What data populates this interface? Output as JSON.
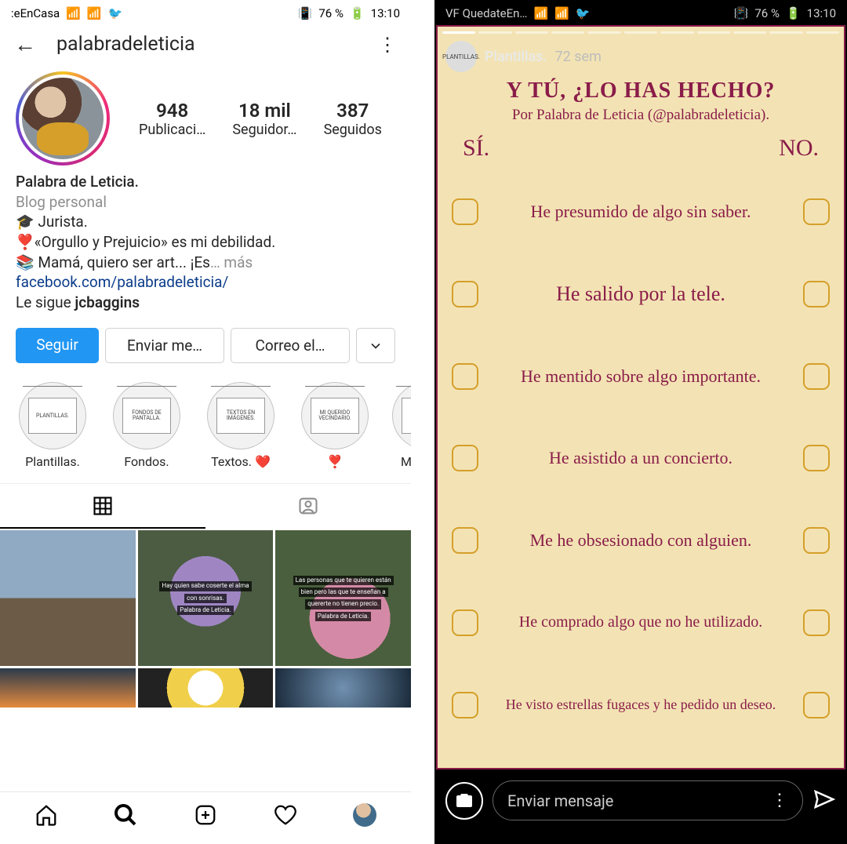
{
  "left": {
    "statusbar": {
      "carrier": ":eEnCasa",
      "battery": "76 %",
      "time": "13:10"
    },
    "topbar": {
      "username": "palabradeleticia"
    },
    "stats": {
      "posts": {
        "num": "948",
        "label": "Publicaci…"
      },
      "followers": {
        "num": "18 mil",
        "label": "Seguidor…"
      },
      "following": {
        "num": "387",
        "label": "Seguidos"
      }
    },
    "bio": {
      "name": "Palabra de Leticia.",
      "category": "Blog personal",
      "line1": "🎓 Jurista.",
      "line2": "❣️«Orgullo y Prejuicio» es mi debilidad.",
      "line3_a": "📚 Mamá, quiero ser art... ¡Es",
      "more": "… más",
      "link": "facebook.com/palabradeleticia/",
      "followed_by_prefix": "Le sigue ",
      "followed_by_name": "jcbaggins"
    },
    "actions": {
      "follow": "Seguir",
      "message": "Enviar me…",
      "email": "Correo el…"
    },
    "highlights": [
      {
        "card": "PLANTILLAS.",
        "label": "Plantillas."
      },
      {
        "card": "FONDOS DE PANTALLA.",
        "label": "Fondos."
      },
      {
        "card": "TEXTOS EN IMÁGENES.",
        "label": "Textos. ❤️"
      },
      {
        "card": "MI QUERIDO VECINDARIO.",
        "label": "❣️"
      },
      {
        "card": "",
        "label": "M"
      }
    ],
    "grid_captions": {
      "c2a": "Hay quien sabe coserte el alma",
      "c2b": "con sonrisas.",
      "c2c": "Palabra de Leticia.",
      "c3a": "Las personas que te quieren están",
      "c3b": "bien pero las que te enseñan a",
      "c3c": "quererte no tienen precio.",
      "c3d": "Palabra de Leticia."
    }
  },
  "right": {
    "statusbar": {
      "carrier": "VF QuedateEn…",
      "battery": "76 %",
      "time": "13:10"
    },
    "header": {
      "name": "Plantillas.",
      "ago": "72 sem"
    },
    "title": "Y TÚ, ¿LO HAS HECHO?",
    "subtitle": "Por Palabra de Leticia (@palabradeleticia).",
    "si": "SÍ.",
    "no": "NO.",
    "questions": [
      "He presumido de algo sin saber.",
      "He salido por la tele.",
      "He mentido sobre algo importante.",
      "He asistido a un concierto.",
      "Me he obsesionado con alguien.",
      "He comprado algo que no he utilizado.",
      "He visto estrellas fugaces y he pedido un deseo."
    ],
    "footer": {
      "placeholder": "Enviar mensaje"
    }
  }
}
